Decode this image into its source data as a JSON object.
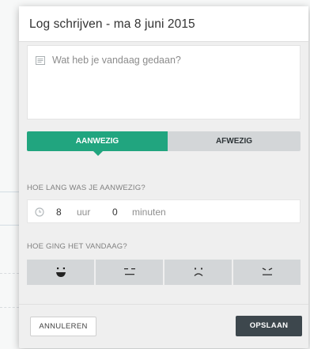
{
  "dialog": {
    "title": "Log schrijven - ma 8 juni 2015"
  },
  "activity": {
    "placeholder": "Wat heb je vandaag gedaan?",
    "icon": "note-icon"
  },
  "attendance": {
    "present_label": "AANWEZIG",
    "absent_label": "AFWEZIG",
    "selected": "AANWEZIG",
    "accent_color": "#21a57f"
  },
  "duration": {
    "label": "HOE LANG WAS JE AANWEZIG?",
    "hours": "8",
    "hours_unit": "uur",
    "minutes": "0",
    "minutes_unit": "minuten",
    "icon": "clock-icon"
  },
  "mood": {
    "label": "HOE GING HET VANDAAG?",
    "options": [
      "very-happy-face-icon",
      "neutral-face-icon",
      "sad-face-icon",
      "angry-face-icon"
    ]
  },
  "actions": {
    "cancel_label": "ANNULEREN",
    "save_label": "OPSLAAN"
  }
}
